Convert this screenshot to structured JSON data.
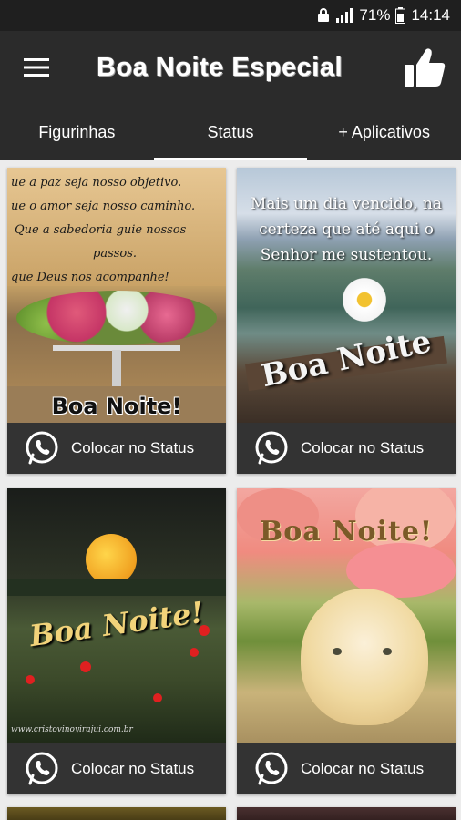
{
  "status_bar": {
    "battery": "71%",
    "time": "14:14"
  },
  "app_bar": {
    "title": "Boa Noite Especial"
  },
  "tabs": [
    {
      "label": "Figurinhas"
    },
    {
      "label": "Status"
    },
    {
      "label": "+ Aplicativos"
    }
  ],
  "cards": [
    {
      "image_lines": [
        "ue a paz seja nosso objetivo.",
        "ue o amor seja nosso caminho.",
        "Que a sabedoria guie nossos",
        "passos.",
        "que Deus  nos acompanhe!"
      ],
      "image_caption": "Boa Noite!",
      "button_label": "Colocar no Status"
    },
    {
      "image_lines": [
        "Mais um dia vencido, na",
        "certeza que até aqui o",
        "Senhor me sustentou."
      ],
      "image_caption": "Boa Noite",
      "button_label": "Colocar no Status"
    },
    {
      "image_caption": "Boa Noite!",
      "image_footer": "www.cristovinoyirajui.com.br",
      "button_label": "Colocar no Status"
    },
    {
      "image_caption": "Boa Noite!",
      "button_label": "Colocar no Status"
    }
  ]
}
